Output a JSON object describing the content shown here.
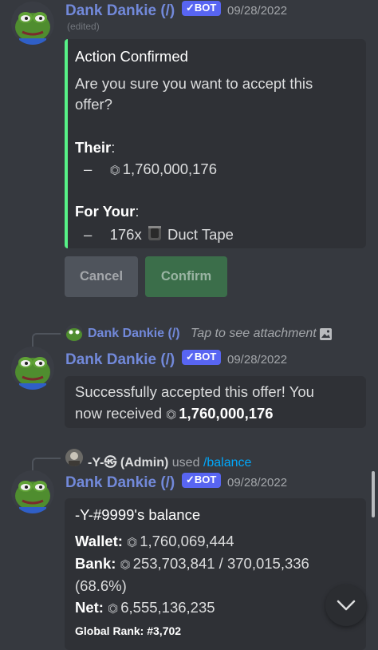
{
  "message1": {
    "author": "Dank Dankie (/)",
    "bot_tag": "✓BOT",
    "timestamp": "09/28/2022",
    "edited": "(edited)",
    "embed": {
      "title": "Action Confirmed",
      "line1": "Are you sure you want to accept this",
      "line2": "offer?",
      "their_label": "Their",
      "their_colon": ":",
      "their_dash": "–",
      "their_value": "1,760,000,176",
      "your_label": "For Your",
      "your_colon": ":",
      "your_dash": "–",
      "your_qty": "176x",
      "your_item": "Duct Tape"
    },
    "buttons": {
      "cancel": "Cancel",
      "confirm": "Confirm"
    }
  },
  "message2": {
    "reply": {
      "author": "Dank Dankie (/)",
      "text": "Tap to see attachment"
    },
    "author": "Dank Dankie (/)",
    "bot_tag": "✓BOT",
    "timestamp": "09/28/2022",
    "embed": {
      "line1": "Successfully accepted this offer! You",
      "line2_prefix": "now received",
      "line2_value": "1,760,000,176"
    }
  },
  "message3": {
    "reply": {
      "user": "-Y-㉿ (Admin)",
      "used": "used",
      "command": "/balance"
    },
    "author": "Dank Dankie (/)",
    "bot_tag": "✓BOT",
    "timestamp": "09/28/2022",
    "embed": {
      "title": "-Y-#9999's balance",
      "wallet_label": "Wallet:",
      "wallet_value": "1,760,069,444",
      "bank_label": "Bank:",
      "bank_value": "253,703,841 / 370,015,336",
      "bank_pct": "(68.6%)",
      "net_label": "Net:",
      "net_value": "6,555,136,235",
      "rank": "Global Rank: #3,702"
    }
  },
  "colors": {
    "accent": "#5865f2",
    "success": "#57f287",
    "confirm_btn": "#3ba55c"
  },
  "icons": {
    "coin": "coin-icon",
    "scroll": "chevron-down-icon",
    "attachment": "image-icon"
  }
}
